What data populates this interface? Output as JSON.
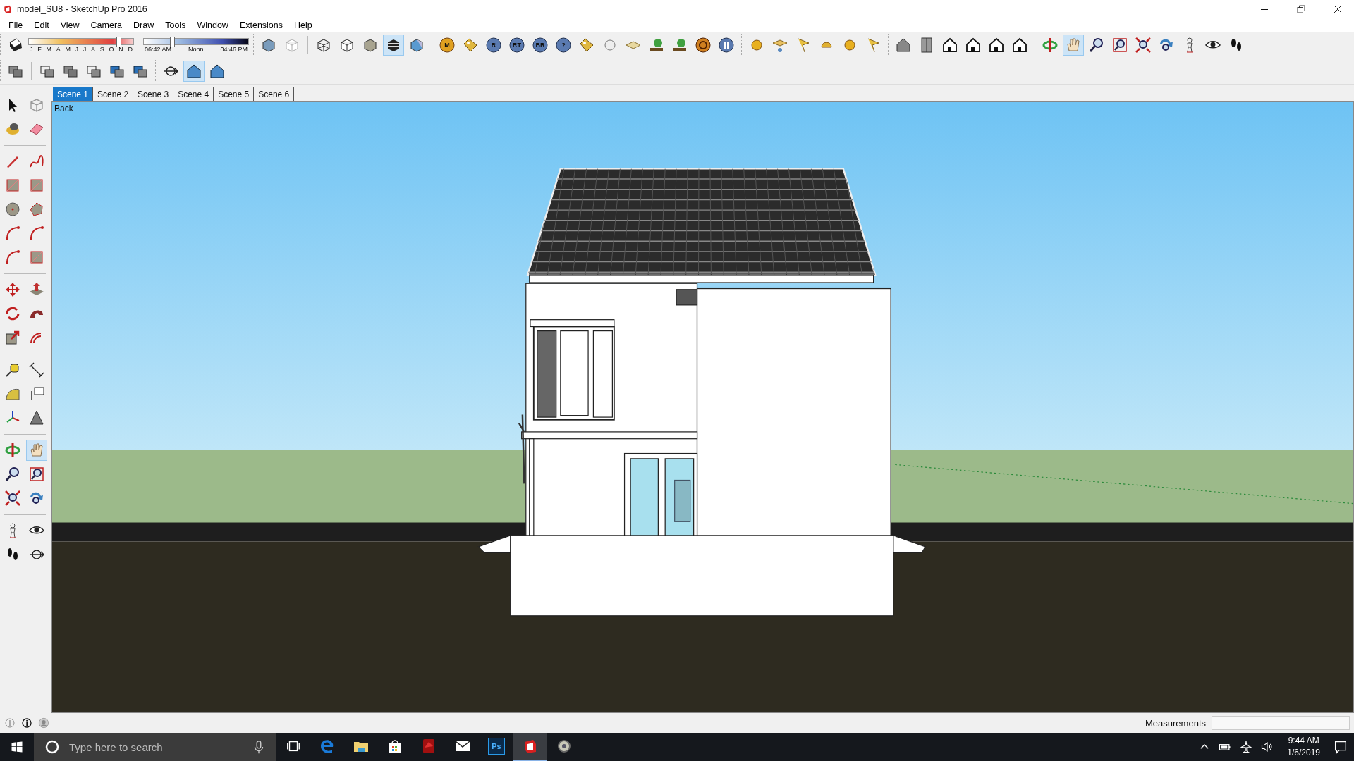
{
  "window": {
    "title": "model_SU8 - SketchUp Pro 2016"
  },
  "menu": [
    "File",
    "Edit",
    "View",
    "Camera",
    "Draw",
    "Tools",
    "Window",
    "Extensions",
    "Help"
  ],
  "shadows": {
    "months": [
      "J",
      "F",
      "M",
      "A",
      "M",
      "J",
      "J",
      "A",
      "S",
      "O",
      "N",
      "D"
    ],
    "month_slider": {
      "level": 0.86
    },
    "times": [
      "06:42 AM",
      "Noon",
      "04:46 PM"
    ],
    "time_slider": {
      "level": 0.27
    }
  },
  "style_toolbar": [
    {
      "selected": false
    },
    {
      "selected": false
    },
    {
      "selected": false
    },
    {
      "selected": false
    },
    {
      "selected": false
    },
    {
      "selected": true
    },
    {
      "selected": false
    }
  ],
  "extension_toolbar": [
    {
      "label": "M",
      "selected": false
    },
    {
      "selected": false
    },
    {
      "label": "R",
      "selected": false
    },
    {
      "label": "RT",
      "selected": false
    },
    {
      "label": "BR",
      "selected": false
    },
    {
      "label": "?",
      "selected": false
    },
    {
      "selected": false
    },
    {
      "selected": false
    },
    {
      "selected": false
    },
    {
      "selected": false
    },
    {
      "selected": false
    },
    {
      "selected": false
    },
    {
      "selected": false
    },
    {
      "selected": false
    },
    {
      "selected": false
    },
    {
      "selected": false
    },
    {
      "selected": false
    },
    {
      "selected": false
    },
    {
      "selected": false
    }
  ],
  "views_toolbar": [
    {
      "selected": false
    },
    {
      "selected": false
    },
    {
      "selected": false
    },
    {
      "selected": false
    },
    {
      "selected": false
    },
    {
      "selected": false
    }
  ],
  "camera_toolbar": [
    {
      "selected": false
    },
    {
      "selected": true
    },
    {
      "selected": false
    },
    {
      "selected": false
    },
    {
      "selected": false
    },
    {
      "selected": false
    },
    {
      "selected": false
    },
    {
      "selected": false
    },
    {
      "selected": false
    }
  ],
  "layer_toolbar": [
    {
      "selected": false
    },
    {
      "selected": false
    },
    {
      "selected": false
    },
    {
      "selected": false
    },
    {
      "selected": false
    },
    {
      "selected": false
    }
  ],
  "projection_toolbar": [
    {
      "selected": false
    },
    {
      "selected": true
    },
    {
      "selected": false
    }
  ],
  "scenes": [
    {
      "label": "Scene 1",
      "selected": true
    },
    {
      "label": "Scene 2",
      "selected": false
    },
    {
      "label": "Scene 3",
      "selected": false
    },
    {
      "label": "Scene 4",
      "selected": false
    },
    {
      "label": "Scene 5",
      "selected": false
    },
    {
      "label": "Scene 6",
      "selected": false
    }
  ],
  "viewport": {
    "view_label": "Back"
  },
  "left_toolbar": [
    {
      "selected": false
    },
    {
      "selected": false
    },
    {
      "selected": false
    },
    {
      "selected": false
    },
    {
      "selected": false
    },
    {
      "selected": false
    },
    {
      "selected": false
    },
    {
      "selected": false
    },
    {
      "selected": false
    },
    {
      "selected": false
    },
    {
      "selected": false
    },
    {
      "selected": false
    },
    {
      "selected": false
    },
    {
      "selected": false
    },
    {
      "selected": false
    },
    {
      "selected": false
    },
    {
      "selected": false
    },
    {
      "selected": false
    },
    {
      "selected": false
    },
    {
      "selected": false
    },
    {
      "selected": false
    },
    {
      "selected": false
    },
    {
      "selected": false
    },
    {
      "selected": false
    },
    {
      "selected": false
    },
    {
      "selected": false
    },
    {
      "selected": false
    },
    {
      "selected": true
    },
    {
      "selected": false
    },
    {
      "selected": false
    },
    {
      "selected": false
    },
    {
      "selected": false
    },
    {
      "selected": false
    },
    {
      "selected": false
    },
    {
      "selected": false
    },
    {
      "selected": false
    }
  ],
  "status_bar": {
    "measurements_label": "Measurements"
  },
  "taskbar": {
    "search": {
      "placeholder": "Type here to search"
    },
    "apps": [
      {
        "selected": false
      },
      {
        "selected": false
      },
      {
        "selected": false
      },
      {
        "selected": false
      },
      {
        "selected": false
      },
      {
        "label": "Ps",
        "selected": false
      },
      {
        "selected": true
      },
      {
        "selected": false
      }
    ],
    "time": "9:44 AM",
    "date": "1/6/2019"
  }
}
